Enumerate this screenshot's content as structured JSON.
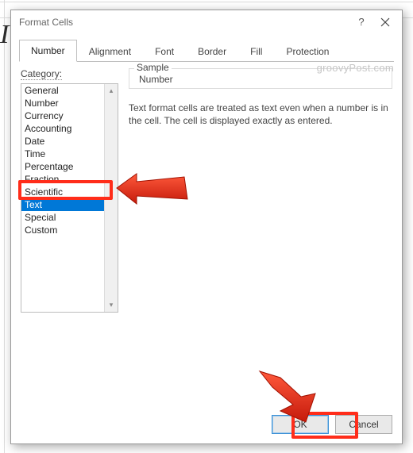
{
  "bg": {
    "big_label": "I"
  },
  "dialog": {
    "title": "Format Cells",
    "tabs": {
      "number": "Number",
      "alignment": "Alignment",
      "font": "Font",
      "border": "Border",
      "fill": "Fill",
      "protection": "Protection"
    },
    "category_label": "Category:",
    "categories": [
      "General",
      "Number",
      "Currency",
      "Accounting",
      "Date",
      "Time",
      "Percentage",
      "Fraction",
      "Scientific",
      "Text",
      "Special",
      "Custom"
    ],
    "selected_category_index": 9,
    "sample_label": "Sample",
    "sample_value": "Number",
    "description": "Text format cells are treated as text even when a number is in the cell. The cell is displayed exactly as entered.",
    "buttons": {
      "ok": "OK",
      "cancel": "Cancel"
    }
  },
  "watermark": "groovyPost.com",
  "annotations": {
    "highlight_category": "Text",
    "highlight_button": "OK"
  }
}
